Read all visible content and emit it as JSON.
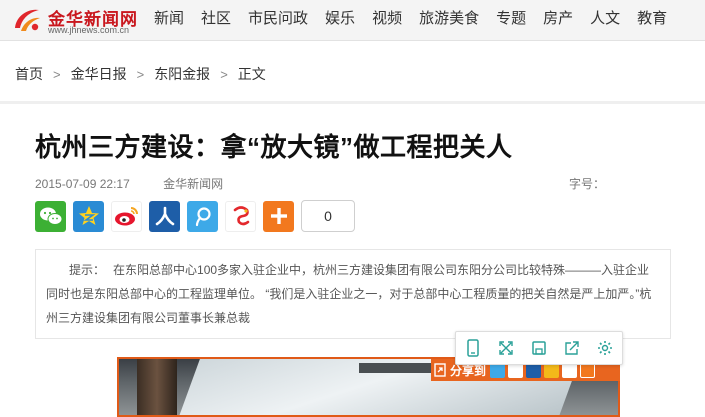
{
  "header": {
    "logo_text": "金华新闻网",
    "logo_url": "www.jhnews.com.cn",
    "nav": [
      "新闻",
      "社区",
      "市民问政",
      "娱乐",
      "视频",
      "旅游美食",
      "专题",
      "房产",
      "人文",
      "教育"
    ]
  },
  "breadcrumb": {
    "items": [
      "首页",
      "金华日报",
      "东阳金报",
      "正文"
    ],
    "separator": ">"
  },
  "article": {
    "title": "杭州三方建设：拿“放大镜”做工程把关人",
    "date": "2015-07-09 22:17",
    "source": "金华新闻网",
    "font_size_label": "字号：",
    "share_count": "0",
    "summary_label": "提示：",
    "summary_text": "在东阳总部中心100多家入驻企业中，杭州三方建设集团有限公司东阳分公司比较特殊———入驻企业同时也是东阳总部中心的工程监理单位。 “我们是入驻企业之一，对于总部中心工程质量的把关自然是严上加严。”杭州三方建设集团有限公司董事长兼总裁"
  },
  "share_icons": [
    "wechat-icon",
    "qzone-icon",
    "weibo-icon",
    "renren-icon",
    "tencent-weibo-icon",
    "sohu-icon",
    "more-icon"
  ],
  "photo_share": {
    "label": "分享到",
    "icons": [
      "tencent-weibo-icon",
      "weibo-icon",
      "renren-icon",
      "kaixin-icon",
      "sohu-icon",
      "more-icon"
    ]
  },
  "colors": {
    "brand_red": "#c9171e",
    "photo_border": "#e05a18",
    "share_bar": "#e8651f",
    "toolbar_icon": "#2aa198"
  }
}
